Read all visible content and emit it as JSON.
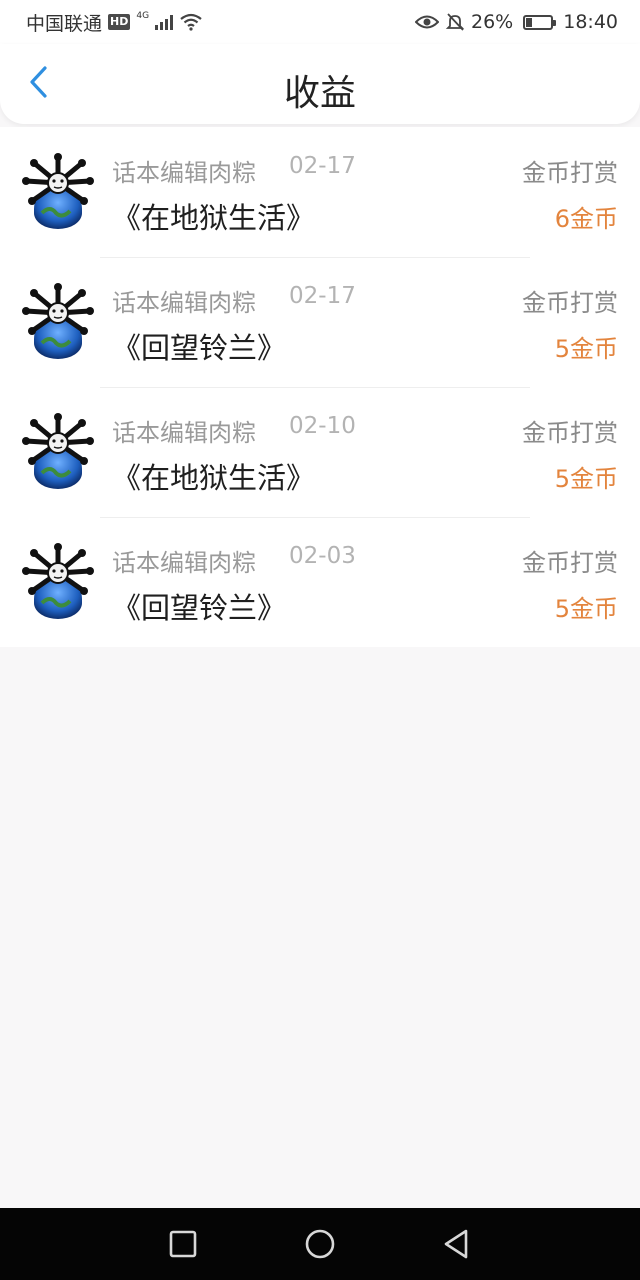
{
  "status_bar": {
    "carrier": "中国联通",
    "hd_badge": "HD",
    "network": "4G",
    "battery_percent": "26%",
    "battery_level": 0.26,
    "time": "18:40"
  },
  "header": {
    "title": "收益",
    "back_icon": "chevron-left-icon",
    "accent_color": "#2f8fe0"
  },
  "records": [
    {
      "editor": "话本编辑肉粽",
      "date": "02-17",
      "type": "金币打赏",
      "title": "《在地狱生活》",
      "amount": "6金币"
    },
    {
      "editor": "话本编辑肉粽",
      "date": "02-17",
      "type": "金币打赏",
      "title": "《回望铃兰》",
      "amount": "5金币"
    },
    {
      "editor": "话本编辑肉粽",
      "date": "02-10",
      "type": "金币打赏",
      "title": "《在地狱生活》",
      "amount": "5金币"
    },
    {
      "editor": "话本编辑肉粽",
      "date": "02-03",
      "type": "金币打赏",
      "title": "《回望铃兰》",
      "amount": "5金币"
    }
  ],
  "colors": {
    "amount": "#e3843d",
    "background": "#f8f7f8"
  },
  "nav_bar": {
    "icons": [
      "square-recents-icon",
      "circle-home-icon",
      "triangle-back-icon"
    ]
  }
}
